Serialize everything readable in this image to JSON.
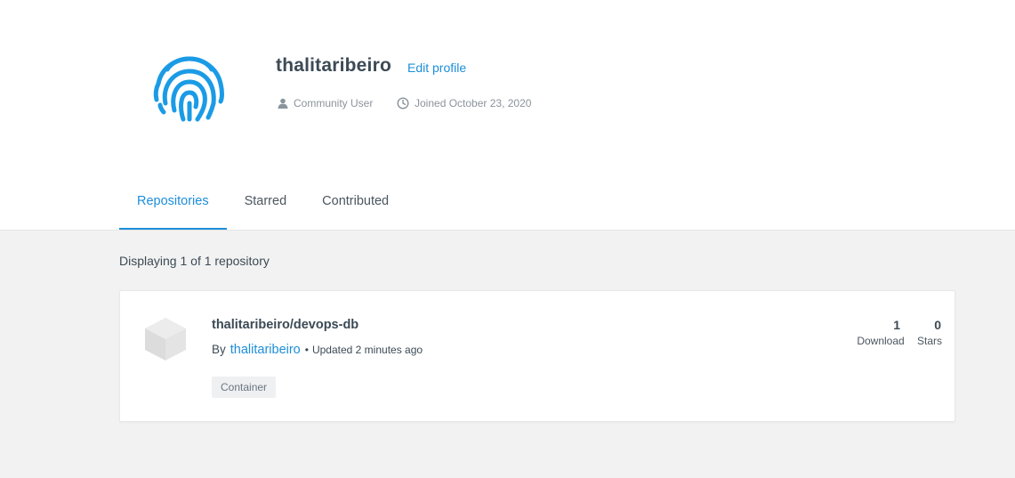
{
  "profile": {
    "username": "thalitaribeiro",
    "edit_label": "Edit profile",
    "role": "Community User",
    "joined": "Joined October 23, 2020",
    "avatar_icon": "fingerprint-icon"
  },
  "tabs": [
    {
      "label": "Repositories",
      "active": true
    },
    {
      "label": "Starred",
      "active": false
    },
    {
      "label": "Contributed",
      "active": false
    }
  ],
  "listing": {
    "count_text": "Displaying 1 of 1 repository"
  },
  "repositories": [
    {
      "name": "thalitaribeiro/devops-db",
      "by_label": "By",
      "owner": "thalitaribeiro",
      "separator": "•",
      "updated": "Updated 2 minutes ago",
      "badge": "Container",
      "downloads": "1",
      "downloads_label": "Download",
      "stars": "0",
      "stars_label": "Stars"
    }
  ],
  "colors": {
    "accent": "#1d8ed9",
    "text": "#3c4a55",
    "muted": "#8a949c",
    "background": "#f2f2f2"
  }
}
